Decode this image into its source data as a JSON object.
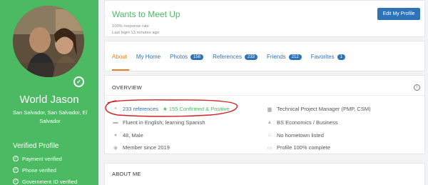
{
  "sidebar": {
    "name": "World Jason",
    "location": "San Salvador, San Salvador, El Salvador",
    "verified_title": "Verified Profile",
    "verifications": [
      "Payment verified",
      "Phone verified",
      "Government ID verified"
    ],
    "accent": "#4cb963"
  },
  "header": {
    "title": "Wants to Meet Up",
    "response_rate": "100% response rate",
    "last_login": "Last login 13 minutes ago",
    "edit_button": "Edit My Profile"
  },
  "tabs": [
    {
      "label": "About",
      "count": null
    },
    {
      "label": "My Home",
      "count": null
    },
    {
      "label": "Photos",
      "count": "158"
    },
    {
      "label": "References",
      "count": "233"
    },
    {
      "label": "Friends",
      "count": "212"
    },
    {
      "label": "Favorites",
      "count": "1"
    }
  ],
  "overview": {
    "title": "OVERVIEW",
    "references": "233 references",
    "confirmed": "155 Confirmed & Positive",
    "language": "Fluent in English; learning Spanish",
    "age_gender": "48, Male",
    "member_since": "Member since 2019",
    "occupation": "Technical Project Manager (PMP, CSM)",
    "education": "BS Economics / Business",
    "hometown": "No hometown listed",
    "profile_complete": "Profile 100% complete"
  },
  "about": {
    "title": "ABOUT ME"
  }
}
